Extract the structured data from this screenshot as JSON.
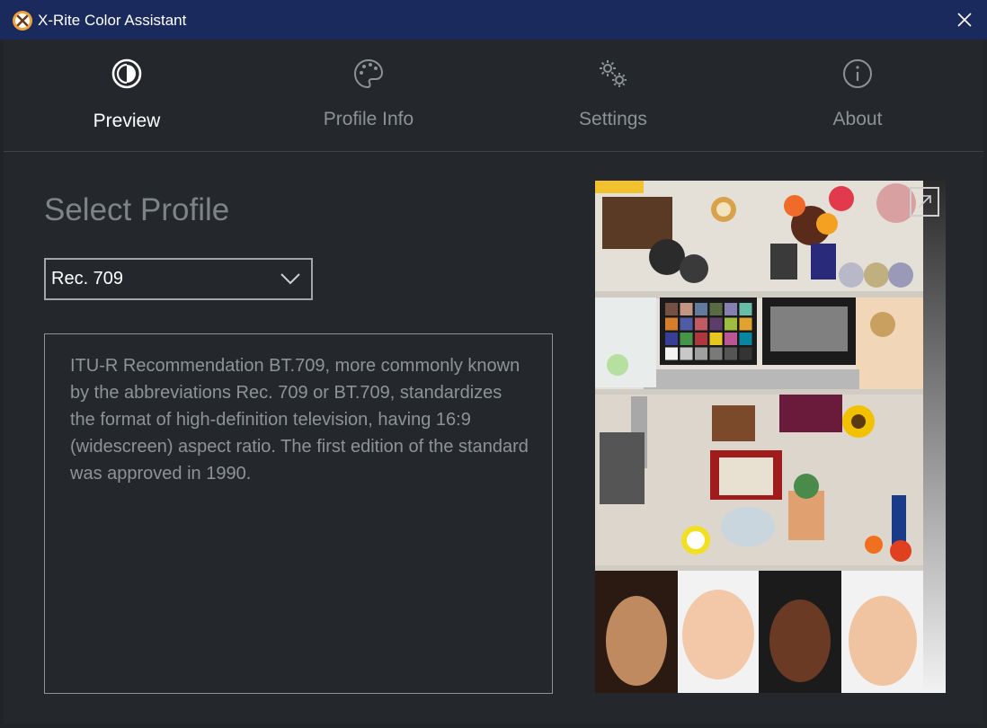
{
  "window": {
    "title": "X-Rite Color Assistant"
  },
  "nav": {
    "tabs": [
      {
        "label": "Preview",
        "icon": "half-circle-contrast-icon",
        "active": true
      },
      {
        "label": "Profile Info",
        "icon": "palette-icon",
        "active": false
      },
      {
        "label": "Settings",
        "icon": "gears-icon",
        "active": false
      },
      {
        "label": "About",
        "icon": "info-icon",
        "active": false
      }
    ]
  },
  "main": {
    "section_title": "Select Profile",
    "profile_select": {
      "selected": "Rec. 709"
    },
    "description": "ITU-R Recommendation BT.709, more commonly known by the abbreviations Rec. 709 or BT.709, standardizes the format of high-definition television, having 16:9 (widescreen) aspect ratio. The first edition of the standard was approved in 1990."
  },
  "preview": {
    "image": "reference test photo: shelves with ColorChecker chart, flowers, toys, and four portrait faces"
  },
  "colors": {
    "titlebar": "#1a2a5c",
    "background": "#24282c",
    "active_text": "#ffffff",
    "inactive_text": "#8d9296"
  }
}
